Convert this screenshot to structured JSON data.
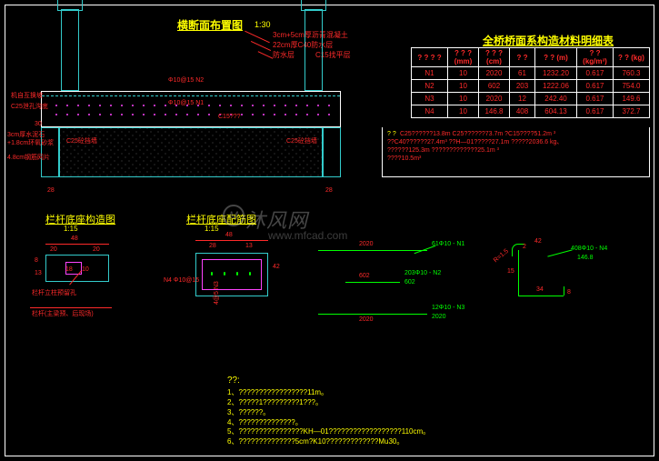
{
  "titles": {
    "cross_section": "横断面布置图",
    "cross_section_scale": "1:30",
    "detail1": "栏杆底座构造图",
    "detail1_scale": "1:15",
    "detail2": "栏杆底座配筋图",
    "detail2_scale": "1:15",
    "table": "全桥桥面系构造材料明细表"
  },
  "cross_section_labels": {
    "pave1": "3cm+5cm厚沥青混凝土",
    "pave2": "22cm厚C40防水层",
    "pave3": "防水层",
    "pave4": "C15找平层",
    "rebar_phi10_n2": "Φ10@15 N2",
    "rebar_phi10_n1": "Φ10@15 N1",
    "rebar_c15_1": "C15???",
    "left_surface": "机自互换坡",
    "left_c25": "C25泄孔沟底",
    "left_layer1": "3cm厚水泥石",
    "left_layer2": "+1.8cm环氧砂浆",
    "left_layer3": "4.8cm钢筋网片",
    "c25_pier_l": "C25砼挡墙",
    "c25_pier_r": "C25砼挡墙",
    "dim_30": "30",
    "dim_28_l": "28",
    "dim_28_r": "28"
  },
  "material_table": {
    "headers": [
      "? ? ? ?",
      "? ? ?\n(mm)",
      "? ? ?\n(cm)",
      "? ?",
      "? ?\n(m)",
      "? ?\n(kg/m³)",
      "? ?\n(kg)"
    ],
    "rows": [
      {
        "name": "N1",
        "dia": "10",
        "len": "2020",
        "qty": "61",
        "total_m": "1232.20",
        "unit": "0.617",
        "wt": "760.3"
      },
      {
        "name": "N2",
        "dia": "10",
        "len": "602",
        "qty": "203",
        "total_m": "1222.06",
        "unit": "0.617",
        "wt": "754.0"
      },
      {
        "name": "N3",
        "dia": "10",
        "len": "2020",
        "qty": "12",
        "total_m": "242.40",
        "unit": "0.617",
        "wt": "149.6"
      },
      {
        "name": "N4",
        "dia": "10",
        "len": "146.8",
        "qty": "408",
        "total_m": "604.13",
        "unit": "0.617",
        "wt": "372.7"
      }
    ],
    "notes_lines": [
      "C25??????13.8m  C25??????73.7m  ?C15????51.2m ³",
      "??C40??????27.4m³  ??H—01?????27.1m  ?????2036.6 kg、",
      "??????125.3m  ?????????????25.1m ³",
      "????10.5m³"
    ]
  },
  "detail1": {
    "dim_48": "48",
    "dim_20_1": "20",
    "dim_18": "18",
    "dim_10": "10",
    "dim_20_2": "20",
    "dim_8": "8",
    "dim_13": "13",
    "label_hole": "栏杆立柱预留孔",
    "label_base": "栏杆(主梁预、后现场)"
  },
  "detail2": {
    "dim_48": "48",
    "dim_28": "28",
    "dim_13": "13",
    "dim_42": "42",
    "rebar_n4": "N4 Φ10@15",
    "rebar_n3": "4@5 N3"
  },
  "rebar_plan": {
    "n1_len": "2020",
    "n1_label": "61Φ10 - N1",
    "n1_len2": "2020",
    "n2_len": "602",
    "n2_label": "203Φ10 - N2",
    "n2_len2": "602",
    "n3_len": "2020",
    "n3_label": "12Φ10 - N3",
    "n3_len2": "2020"
  },
  "stirrup": {
    "dim_42": "42",
    "dim_34": "34",
    "dim_8": "8",
    "dim_15": "15",
    "n4_label": "408Φ10 - N4",
    "n4_len": "146.8",
    "r_label": "R=1.5",
    "dim_2": "2"
  },
  "notes": {
    "title": "??:",
    "lines": [
      "1、?????????????????11m。",
      "2、?????1?????????1???。",
      "3、??????。",
      "4、??????????????。",
      "5、????????????????KH—01??????????????????110cm。",
      "6、??????????????5cm?K10?????????????Mu30。"
    ]
  },
  "watermark": {
    "brand": "沐风网",
    "url": "www.mfcad.com",
    "logo": "M"
  }
}
